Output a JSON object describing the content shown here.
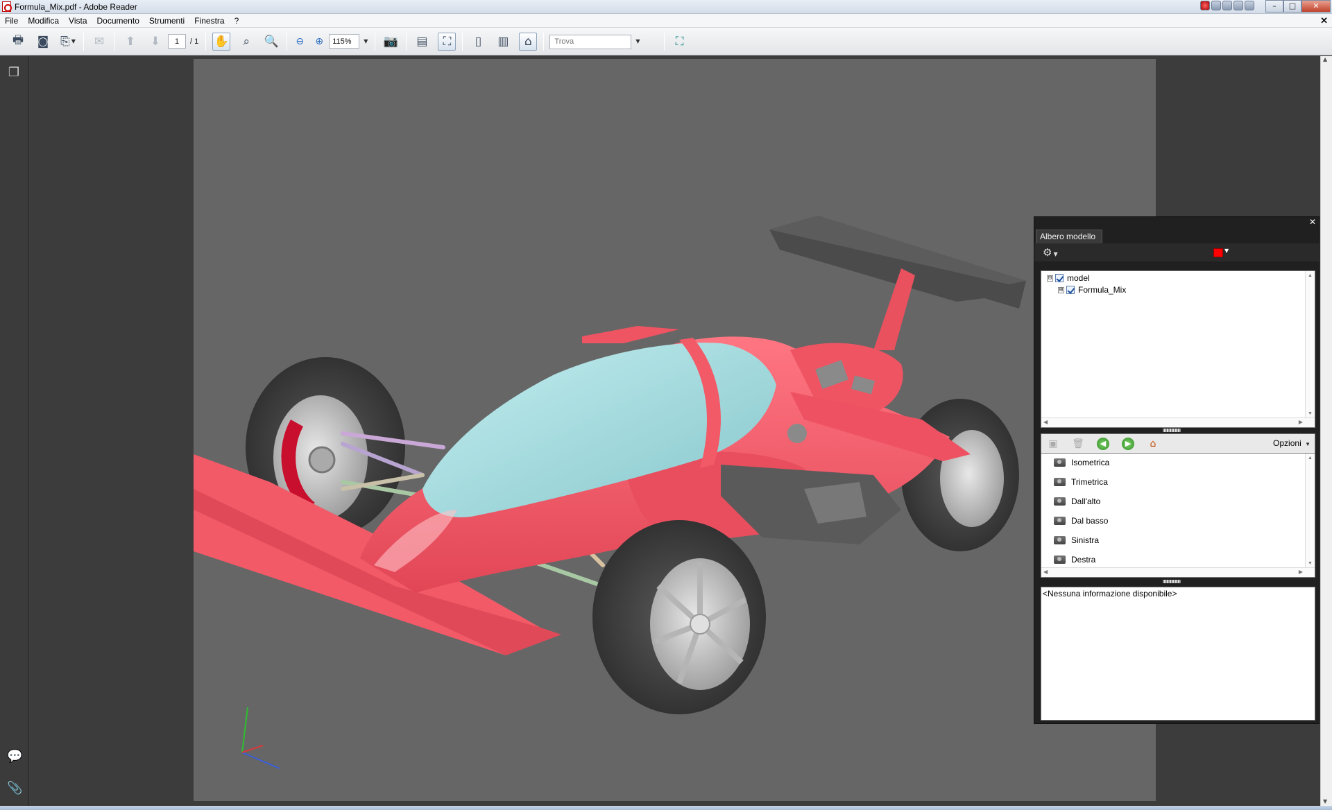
{
  "window": {
    "title": "Formula_Mix.pdf - Adobe Reader"
  },
  "menu": {
    "items": [
      "File",
      "Modifica",
      "Vista",
      "Documento",
      "Strumenti",
      "Finestra",
      "?"
    ]
  },
  "toolbar": {
    "page_current": "1",
    "page_total": "/ 1",
    "zoom": "115%",
    "find_placeholder": "Trova"
  },
  "model_tree": {
    "tab_label": "Albero modello",
    "swatch_color": "#ff0000",
    "nodes": [
      {
        "label": "model",
        "expander": "⊟"
      },
      {
        "label": "Formula_Mix",
        "expander": "⊞"
      }
    ],
    "options_label": "Opzioni",
    "views": [
      "Isometrica",
      "Trimetrica",
      "Dall'alto",
      "Dal basso",
      "Sinistra",
      "Destra"
    ],
    "info_text": "<Nessuna informazione disponibile>"
  },
  "scene": {
    "background": "#666666",
    "body_color": "#f25a68",
    "canopy_color": "#a6dde0",
    "tire_color": "#4a4a4a",
    "rim_color": "#cfcfcf",
    "caliper_color": "#c8102e"
  }
}
